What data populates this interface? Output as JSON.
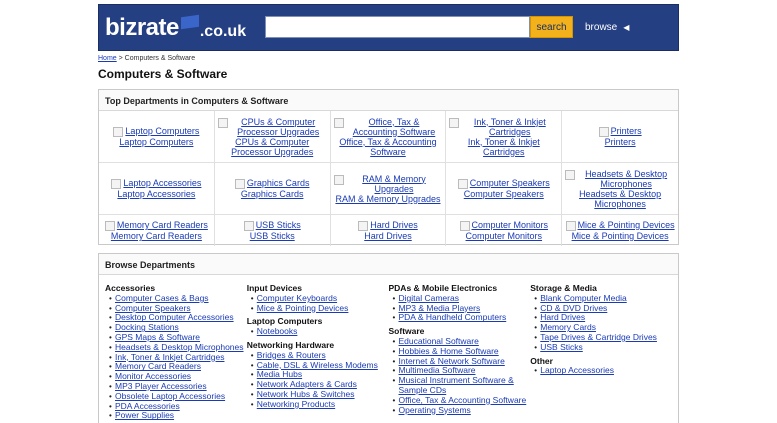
{
  "header": {
    "logo_main": "bizrate",
    "logo_suffix": ".co.uk",
    "search_placeholder": "",
    "search_button": "search",
    "browse_button": "browse"
  },
  "breadcrumb": {
    "home": "Home",
    "separator": " > ",
    "current": "Computers & Software"
  },
  "page_title": "Computers & Software",
  "top_departments": {
    "heading": "Top Departments in Computers & Software",
    "items": [
      {
        "img": "Laptop Computers",
        "label": "Laptop Computers"
      },
      {
        "img": "CPUs & Computer Processor Upgrades",
        "label": "CPUs & Computer Processor Upgrades"
      },
      {
        "img": "Office, Tax & Accounting Software",
        "label": "Office, Tax & Accounting Software"
      },
      {
        "img": "Ink, Toner & Inkjet Cartridges",
        "label": "Ink, Toner & Inkjet Cartridges"
      },
      {
        "img": "Printers",
        "label": "Printers"
      },
      {
        "img": "Laptop Accessories",
        "label": "Laptop Accessories"
      },
      {
        "img": "Graphics Cards",
        "label": "Graphics Cards"
      },
      {
        "img": "RAM & Memory Upgrades",
        "label": "RAM & Memory Upgrades"
      },
      {
        "img": "Computer Speakers",
        "label": "Computer Speakers"
      },
      {
        "img": "Headsets & Desktop Microphones",
        "label": "Headsets & Desktop Microphones"
      },
      {
        "img": "Memory Card Readers",
        "label": "Memory Card Readers"
      },
      {
        "img": "USB Sticks",
        "label": "USB Sticks"
      },
      {
        "img": "Hard Drives",
        "label": "Hard Drives"
      },
      {
        "img": "Computer Monitors",
        "label": "Computer Monitors"
      },
      {
        "img": "Mice & Pointing Devices",
        "label": "Mice & Pointing Devices"
      }
    ]
  },
  "browse_departments": {
    "heading": "Browse Departments",
    "columns": [
      {
        "groups": [
          {
            "title": "Accessories",
            "links": [
              "Computer Cases & Bags",
              "Computer Speakers",
              "Desktop Computer Accessories",
              "Docking Stations",
              "GPS Maps & Software",
              "Headsets & Desktop Microphones",
              "Ink, Toner & Inkjet Cartridges",
              "Memory Card Readers",
              "Monitor Accessories",
              "MP3 Player Accessories",
              "Obsolete Laptop Accessories",
              "PDA Accessories",
              "Power Supplies"
            ]
          }
        ]
      },
      {
        "groups": [
          {
            "title": "Input Devices",
            "links": [
              "Computer Keyboards",
              "Mice & Pointing Devices"
            ]
          },
          {
            "title": "Laptop Computers",
            "links": [
              "Notebooks"
            ]
          },
          {
            "title": "Networking Hardware",
            "links": [
              "Bridges & Routers",
              "Cable, DSL & Wireless Modems",
              "Media Hubs",
              "Network Adapters & Cards",
              "Network Hubs & Switches",
              "Networking Products"
            ]
          }
        ]
      },
      {
        "groups": [
          {
            "title": "PDAs & Mobile Electronics",
            "links": [
              "Digital Cameras",
              "MP3 & Media Players",
              "PDA & Handheld Computers"
            ]
          },
          {
            "title": "Software",
            "links": [
              "Educational Software",
              "Hobbies & Home Software",
              "Internet & Network Software",
              "Multimedia Software",
              "Musical Instrument Software & Sample CDs",
              "Office, Tax & Accounting Software",
              "Operating Systems"
            ]
          }
        ]
      },
      {
        "groups": [
          {
            "title": "Storage & Media",
            "links": [
              "Blank Computer Media",
              "CD & DVD Drives",
              "Hard Drives",
              "Memory Cards",
              "Tape Drives & Cartridge Drives",
              "USB Sticks"
            ]
          },
          {
            "title": "Other",
            "links": [
              "Laptop Accessories"
            ]
          }
        ]
      }
    ]
  }
}
